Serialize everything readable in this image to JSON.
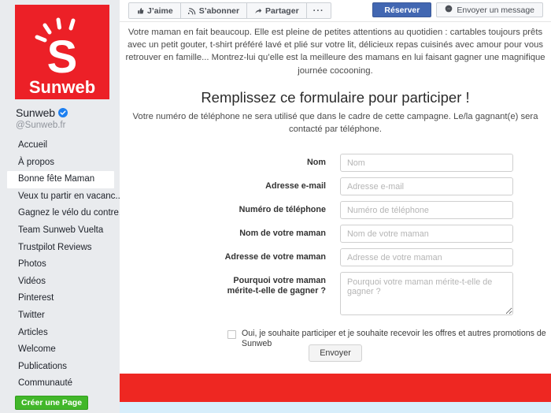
{
  "sidebar": {
    "logo": {
      "icon": "sunweb-sun-s-logo",
      "wordmark": "Sunweb",
      "background_color": "#ec2027"
    },
    "page_name": "Sunweb",
    "verified_icon": "verified-badge-icon",
    "handle": "@Sunweb.fr",
    "nav_items": [
      {
        "label": "Accueil",
        "active": false
      },
      {
        "label": "À propos",
        "active": false
      },
      {
        "label": "Bonne fête Maman",
        "active": true
      },
      {
        "label": "Veux tu partir en vacanc...",
        "active": false
      },
      {
        "label": "Gagnez le vélo du contre...",
        "active": false
      },
      {
        "label": "Team Sunweb Vuelta",
        "active": false
      },
      {
        "label": "Trustpilot Reviews",
        "active": false
      },
      {
        "label": "Photos",
        "active": false
      },
      {
        "label": "Vidéos",
        "active": false
      },
      {
        "label": "Pinterest",
        "active": false
      },
      {
        "label": "Twitter",
        "active": false
      },
      {
        "label": "Articles",
        "active": false
      },
      {
        "label": "Welcome",
        "active": false
      },
      {
        "label": "Publications",
        "active": false
      },
      {
        "label": "Communauté",
        "active": false
      }
    ],
    "create_page_button": "Créer une Page",
    "create_page_color": "#42b72a"
  },
  "action_bar": {
    "like_label": "J’aime",
    "like_icon": "thumbs-up-icon",
    "follow_label": "S’abonner",
    "follow_icon": "rss-follow-icon",
    "share_label": "Partager",
    "share_icon": "share-arrow-icon",
    "more_label": "···",
    "reserve_label": "Réserver",
    "reserve_color": "#4267b2",
    "message_label": "Envoyer un message",
    "message_icon": "messenger-icon"
  },
  "content": {
    "intro": "Votre maman en fait beaucoup. Elle est pleine de petites attentions au quotidien : cartables toujours prêts avec un petit gouter, t-shirt préféré lavé et plié sur votre lit, délicieux repas cuisinés avec amour pour vous retrouver en famille... Montrez-lui qu’elle est la meilleure des mamans en lui faisant gagner une magnifique journée cocooning.",
    "form_heading": "Remplissez ce formulaire pour participer !",
    "form_subtitle": "Votre numéro de téléphone ne sera utilisé que dans le cadre de cette campagne. Le/la gagnant(e) sera contacté par téléphone."
  },
  "form": {
    "fields": [
      {
        "label": "Nom",
        "label_line2": "",
        "placeholder": "Nom",
        "value": "",
        "type": "text"
      },
      {
        "label": "Adresse e-mail",
        "label_line2": "",
        "placeholder": "Adresse e-mail",
        "value": "",
        "type": "text"
      },
      {
        "label": "Numéro de téléphone",
        "label_line2": "",
        "placeholder": "Numéro de téléphone",
        "value": "",
        "type": "text"
      },
      {
        "label": "Nom de votre maman",
        "label_line2": "",
        "placeholder": "Nom de votre maman",
        "value": "",
        "type": "text"
      },
      {
        "label": "Adresse de votre maman",
        "label_line2": "",
        "placeholder": "Adresse de votre maman",
        "value": "",
        "type": "text"
      },
      {
        "label": "Pourquoi votre maman",
        "label_line2": "mérite-t-elle de gagner ?",
        "placeholder": "Pourquoi votre maman mérite-t-elle de gagner ?",
        "value": "",
        "type": "textarea"
      }
    ],
    "consent_text": "Oui, je souhaite participer et je souhaite recevoir les offres et autres promotions de Sunweb",
    "consent_checked": false,
    "submit_label": "Envoyer"
  },
  "footer": {
    "band_color": "#ee2722",
    "strip_color": "#d7eefb"
  }
}
